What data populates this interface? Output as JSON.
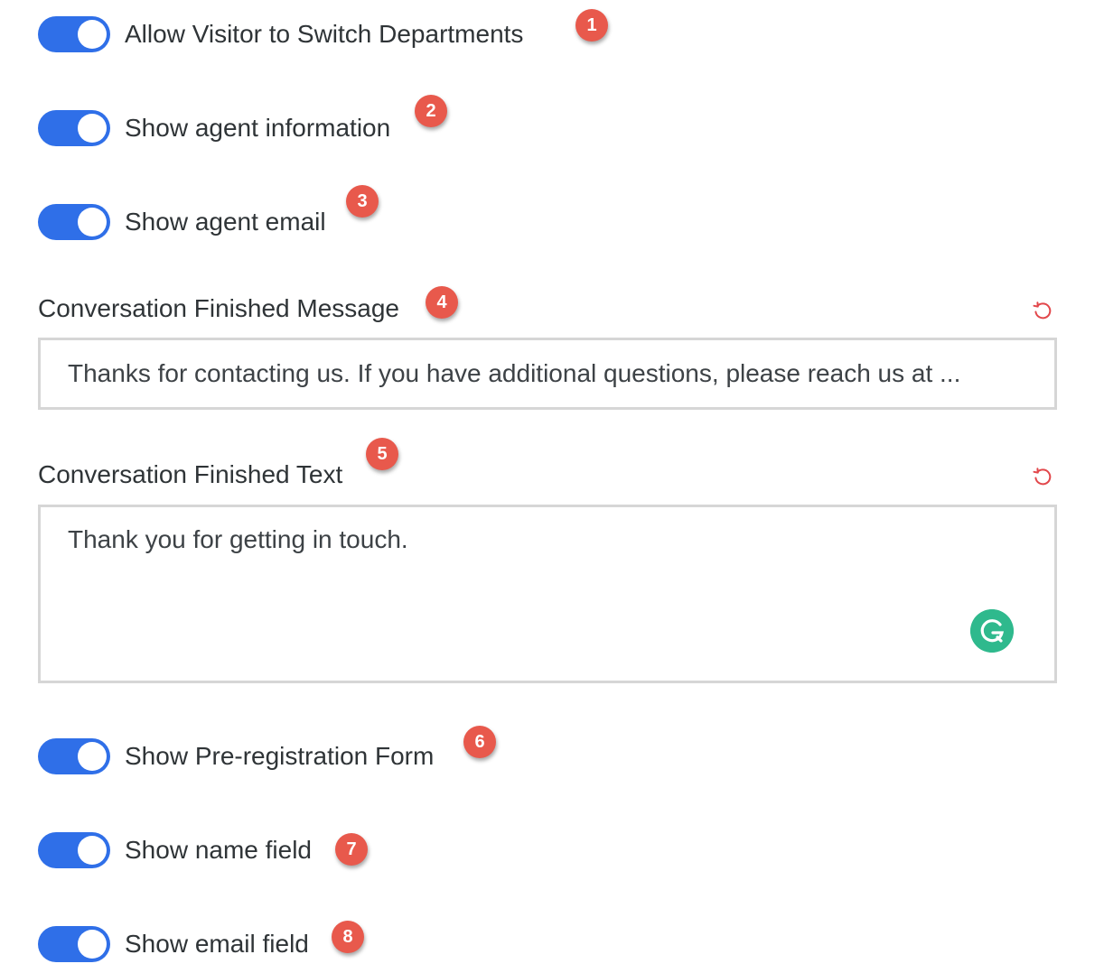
{
  "settings": {
    "switch_departments": {
      "label": "Allow Visitor to Switch Departments",
      "enabled": true,
      "badge": "1"
    },
    "agent_information": {
      "label": "Show agent information",
      "enabled": true,
      "badge": "2"
    },
    "agent_email": {
      "label": "Show agent email",
      "enabled": true,
      "badge": "3"
    },
    "finished_message": {
      "label": "Conversation Finished Message",
      "badge": "4",
      "value": "Thanks for contacting us. If you have additional questions, please reach us at ..."
    },
    "finished_text": {
      "label": "Conversation Finished Text",
      "badge": "5",
      "value": "Thank you for getting in touch."
    },
    "pre_registration": {
      "label": "Show Pre-registration Form",
      "enabled": true,
      "badge": "6"
    },
    "name_field": {
      "label": "Show name field",
      "enabled": true,
      "badge": "7"
    },
    "email_field": {
      "label": "Show email field",
      "enabled": true,
      "badge": "8"
    }
  },
  "icons": {
    "reset": "reset-icon",
    "grammarly": "grammarly-icon"
  },
  "colors": {
    "toggle_on": "#2f6fe8",
    "badge": "#e8594c",
    "reset_icon": "#e2474b",
    "grammarly": "#2fb98d"
  }
}
